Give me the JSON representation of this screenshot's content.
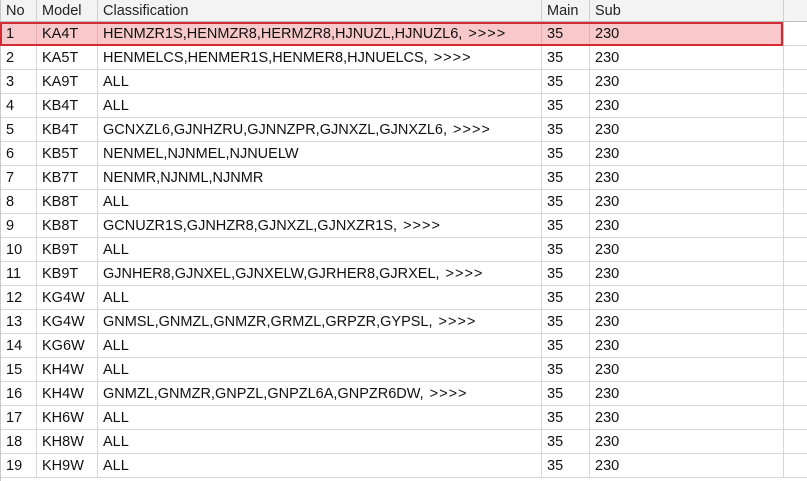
{
  "columns": {
    "no": "No",
    "model": "Model",
    "classification": "Classification",
    "main": "Main",
    "sub": "Sub"
  },
  "more_marker": ">>>>",
  "selected_row": 0,
  "colors": {
    "selection_fill": "#f8c8cb",
    "selection_border": "#d42a31",
    "header_bg": "#f3f3f3",
    "grid_line": "#d6d6d6"
  },
  "rows": [
    {
      "no": "1",
      "model": "KA4T",
      "classification": "HENMZR1S,HENMZR8,HERMZR8,HJNUZL,HJNUZL6,",
      "more": true,
      "main": "35",
      "sub": "230"
    },
    {
      "no": "2",
      "model": "KA5T",
      "classification": "HENMELCS,HENMER1S,HENMER8,HJNUELCS,",
      "more": true,
      "main": "35",
      "sub": "230"
    },
    {
      "no": "3",
      "model": "KA9T",
      "classification": "ALL",
      "more": false,
      "main": "35",
      "sub": "230"
    },
    {
      "no": "4",
      "model": "KB4T",
      "classification": "ALL",
      "more": false,
      "main": "35",
      "sub": "230"
    },
    {
      "no": "5",
      "model": "KB4T",
      "classification": "GCNXZL6,GJNHZRU,GJNNZPR,GJNXZL,GJNXZL6,",
      "more": true,
      "main": "35",
      "sub": "230"
    },
    {
      "no": "6",
      "model": "KB5T",
      "classification": "NENMEL,NJNMEL,NJNUELW",
      "more": false,
      "main": "35",
      "sub": "230"
    },
    {
      "no": "7",
      "model": "KB7T",
      "classification": "NENMR,NJNML,NJNMR",
      "more": false,
      "main": "35",
      "sub": "230"
    },
    {
      "no": "8",
      "model": "KB8T",
      "classification": "ALL",
      "more": false,
      "main": "35",
      "sub": "230"
    },
    {
      "no": "9",
      "model": "KB8T",
      "classification": "GCNUZR1S,GJNHZR8,GJNXZL,GJNXZR1S,",
      "more": true,
      "main": "35",
      "sub": "230"
    },
    {
      "no": "10",
      "model": "KB9T",
      "classification": "ALL",
      "more": false,
      "main": "35",
      "sub": "230"
    },
    {
      "no": "11",
      "model": "KB9T",
      "classification": "GJNHER8,GJNXEL,GJNXELW,GJRHER8,GJRXEL,",
      "more": true,
      "main": "35",
      "sub": "230"
    },
    {
      "no": "12",
      "model": "KG4W",
      "classification": "ALL",
      "more": false,
      "main": "35",
      "sub": "230"
    },
    {
      "no": "13",
      "model": "KG4W",
      "classification": "GNMSL,GNMZL,GNMZR,GRMZL,GRPZR,GYPSL,",
      "more": true,
      "main": "35",
      "sub": "230"
    },
    {
      "no": "14",
      "model": "KG6W",
      "classification": "ALL",
      "more": false,
      "main": "35",
      "sub": "230"
    },
    {
      "no": "15",
      "model": "KH4W",
      "classification": "ALL",
      "more": false,
      "main": "35",
      "sub": "230"
    },
    {
      "no": "16",
      "model": "KH4W",
      "classification": "GNMZL,GNMZR,GNPZL,GNPZL6A,GNPZR6DW,",
      "more": true,
      "main": "35",
      "sub": "230"
    },
    {
      "no": "17",
      "model": "KH6W",
      "classification": "ALL",
      "more": false,
      "main": "35",
      "sub": "230"
    },
    {
      "no": "18",
      "model": "KH8W",
      "classification": "ALL",
      "more": false,
      "main": "35",
      "sub": "230"
    },
    {
      "no": "19",
      "model": "KH9W",
      "classification": "ALL",
      "more": false,
      "main": "35",
      "sub": "230"
    }
  ]
}
